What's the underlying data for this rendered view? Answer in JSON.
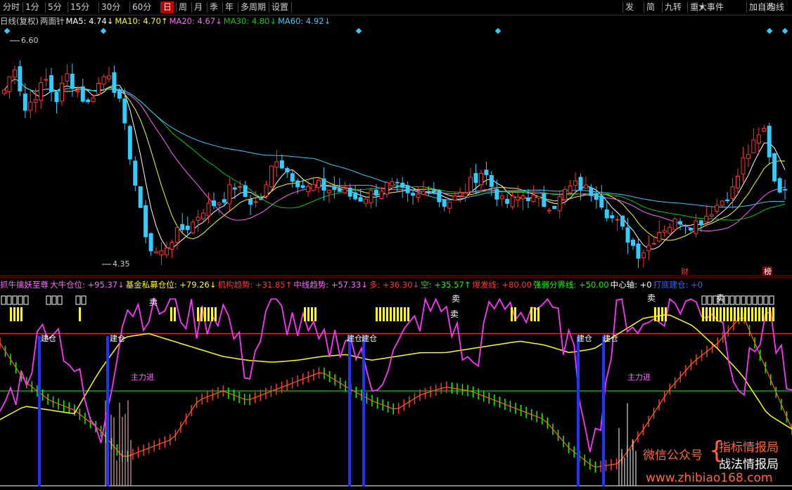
{
  "toolbar": {
    "periods": [
      "分时",
      "1分",
      "5分",
      "15分",
      "30分",
      "60分",
      "日",
      "周",
      "月",
      "季",
      "年",
      "多周期",
      "设置"
    ],
    "selected": "日",
    "right_tools": [
      "发",
      "简",
      "九转",
      "重大事件",
      "▾",
      "加自选",
      "均线"
    ]
  },
  "price_header": {
    "title": "日线(复权)",
    "subtitle": "两面针",
    "ma": [
      {
        "label": "MA5: 4.74↓",
        "color": "#ffffff"
      },
      {
        "label": "MA10: 4.70↑",
        "color": "#ffff00"
      },
      {
        "label": "MA20: 4.67↓",
        "color": "#ff66ff"
      },
      {
        "label": "MA30: 4.80↓",
        "color": "#00cc00"
      },
      {
        "label": "MA60: 4.92↓",
        "color": "#33ccff"
      }
    ]
  },
  "indicator_header": [
    {
      "label": "抓牛擒妖至尊",
      "color": "#ff66ff"
    },
    {
      "label": "大牛仓位: +95.37↓",
      "color": "#ff66ff"
    },
    {
      "label": "基金私募仓位: +79.26↓",
      "color": "#ffff00"
    },
    {
      "label": "机构趋势: +31.85↑",
      "color": "#ff3333"
    },
    {
      "label": "中线趋势: +57.33↓",
      "color": "#ff66ff"
    },
    {
      "label": "多: +36.30↓",
      "color": "#ff3333"
    },
    {
      "label": "空: +35.57↑",
      "color": "#00ff00"
    },
    {
      "label": "爆发线: +80.00",
      "color": "#ff3333"
    },
    {
      "label": "强弱分界线: +50.00",
      "color": "#00ff00"
    },
    {
      "label": "中心轴: +0",
      "color": "#ffffff"
    },
    {
      "label": "打底建仓: +0",
      "color": "#3366ff"
    }
  ],
  "chart_data": [
    {
      "type": "candlestick",
      "title": "两面针",
      "ylim": [
        4.35,
        6.6
      ],
      "annotations": {
        "high": "6.60",
        "low": "4.35",
        "markers": [
          "财",
          "榜"
        ]
      },
      "series": [
        {
          "name": "MA5",
          "color": "#ffffff",
          "values": [
            4.74
          ]
        },
        {
          "name": "MA10",
          "color": "#ffff00",
          "values": [
            4.7
          ]
        },
        {
          "name": "MA20",
          "color": "#ff66ff",
          "values": [
            4.67
          ]
        },
        {
          "name": "MA30",
          "color": "#00cc00",
          "values": [
            4.8
          ]
        },
        {
          "name": "MA60",
          "color": "#33ccff",
          "values": [
            4.92
          ]
        }
      ],
      "close_trend": [
        6.1,
        6.35,
        5.9,
        6.05,
        6.2,
        6.0,
        6.25,
        6.1,
        5.95,
        6.15,
        6.3,
        6.0,
        5.5,
        4.9,
        4.5,
        4.45,
        4.6,
        4.7,
        4.75,
        4.9,
        4.95,
        5.0,
        5.15,
        5.05,
        4.95,
        5.05,
        5.45,
        5.3,
        5.2,
        5.1,
        5.15,
        5.1,
        5.1,
        5.05,
        5.0,
        5.05,
        5.1,
        5.15,
        5.1,
        5.0,
        5.05,
        5.15,
        4.95,
        5.0,
        5.05,
        5.2,
        5.3,
        5.1,
        4.95,
        5.0,
        5.05,
        5.0,
        4.95,
        4.95,
        5.1,
        5.15,
        5.1,
        5.05,
        4.85,
        4.75,
        4.6,
        4.45,
        4.55,
        4.7,
        4.75,
        4.8,
        4.75,
        4.8,
        4.9,
        5.0,
        5.1,
        5.4,
        5.55,
        5.7,
        5.2,
        5.05
      ]
    },
    {
      "type": "line",
      "title": "抓牛擒妖至尊",
      "ylim": [
        0,
        100
      ],
      "series": [
        {
          "name": "大牛仓位",
          "color": "#ff66ff",
          "values": [
            95.37
          ]
        },
        {
          "name": "基金私募仓位",
          "color": "#ffff00",
          "values": [
            79.26
          ]
        },
        {
          "name": "机构趋势",
          "color": "#ff3333",
          "values": [
            31.85
          ]
        },
        {
          "name": "中线趋势",
          "color": "#ff66ff",
          "values": [
            57.33
          ]
        },
        {
          "name": "多",
          "color": "#ff3333",
          "values": [
            36.3
          ]
        },
        {
          "name": "空",
          "color": "#00ff00",
          "values": [
            35.57
          ]
        },
        {
          "name": "爆发线",
          "color": "#ff3333",
          "values": [
            80.0
          ]
        },
        {
          "name": "强弱分界线",
          "color": "#00ff00",
          "values": [
            50.0
          ]
        },
        {
          "name": "中心轴",
          "color": "#ffffff",
          "values": [
            0
          ]
        },
        {
          "name": "打底建仓",
          "color": "#3366ff",
          "values": [
            0
          ]
        }
      ],
      "annotations": {
        "sell": "卖",
        "build": "建仓",
        "main_in": "主力进"
      }
    }
  ],
  "watermark": {
    "wechat": "微信公众号",
    "name1": "指标情报局",
    "name2": "战法情报局",
    "site": "www.zhibiao168.com"
  }
}
